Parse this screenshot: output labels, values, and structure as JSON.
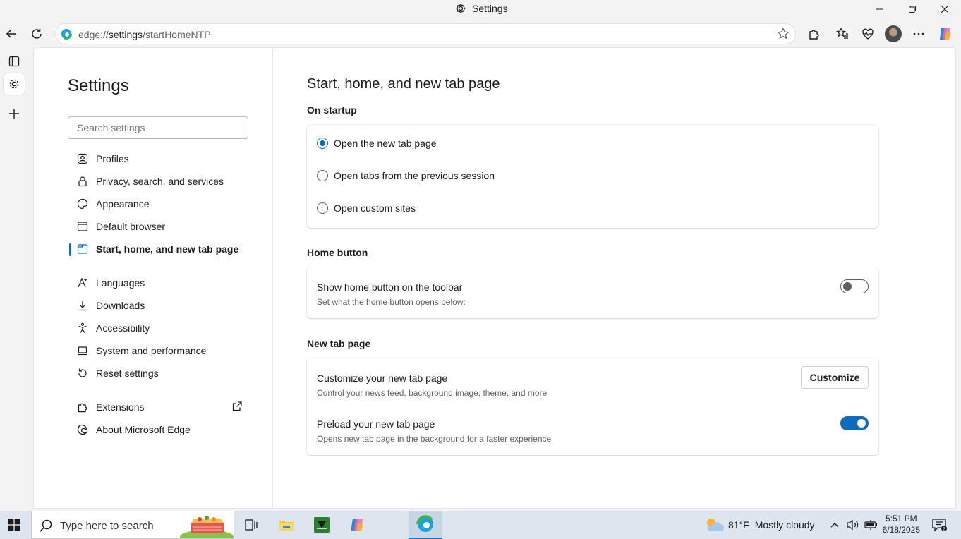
{
  "window": {
    "title": "Settings"
  },
  "address": {
    "prefix": "edge://",
    "domain": "settings",
    "path": "/startHomeNTP"
  },
  "sidebar": {
    "title": "Settings",
    "search_placeholder": "Search settings",
    "items": [
      {
        "label": "Profiles",
        "icon": "profile-icon"
      },
      {
        "label": "Privacy, search, and services",
        "icon": "lock-icon"
      },
      {
        "label": "Appearance",
        "icon": "palette-icon"
      },
      {
        "label": "Default browser",
        "icon": "browser-icon"
      },
      {
        "label": "Start, home, and new tab page",
        "icon": "home-tab-icon",
        "active": true
      },
      {
        "label": "Languages",
        "icon": "languages-icon"
      },
      {
        "label": "Downloads",
        "icon": "download-icon"
      },
      {
        "label": "Accessibility",
        "icon": "accessibility-icon"
      },
      {
        "label": "System and performance",
        "icon": "laptop-icon"
      },
      {
        "label": "Reset settings",
        "icon": "reset-icon"
      },
      {
        "label": "Extensions",
        "icon": "extensions-icon"
      },
      {
        "label": "About Microsoft Edge",
        "icon": "edge-icon"
      }
    ]
  },
  "main": {
    "title": "Start, home, and new tab page",
    "startup": {
      "heading": "On startup",
      "options": [
        {
          "label": "Open the new tab page",
          "checked": true
        },
        {
          "label": "Open tabs from the previous session",
          "checked": false
        },
        {
          "label": "Open custom sites",
          "checked": false
        }
      ]
    },
    "home": {
      "heading": "Home button",
      "label": "Show home button on the toolbar",
      "sub": "Set what the home button opens below:",
      "enabled": false
    },
    "ntp": {
      "heading": "New tab page",
      "customize_label": "Customize your new tab page",
      "customize_sub": "Control your news feed, background image, theme, and more",
      "customize_button": "Customize",
      "preload_label": "Preload your new tab page",
      "preload_sub": "Opens new tab page in the background for a faster experience",
      "preload_enabled": true
    }
  },
  "taskbar": {
    "search_placeholder": "Type here to search",
    "weather_temp": "81°F",
    "weather_desc": "Mostly cloudy",
    "time": "5:51 PM",
    "date": "6/18/2025"
  },
  "colors": {
    "accent": "#0f6cbd",
    "taskbar": "#dde6ee"
  }
}
